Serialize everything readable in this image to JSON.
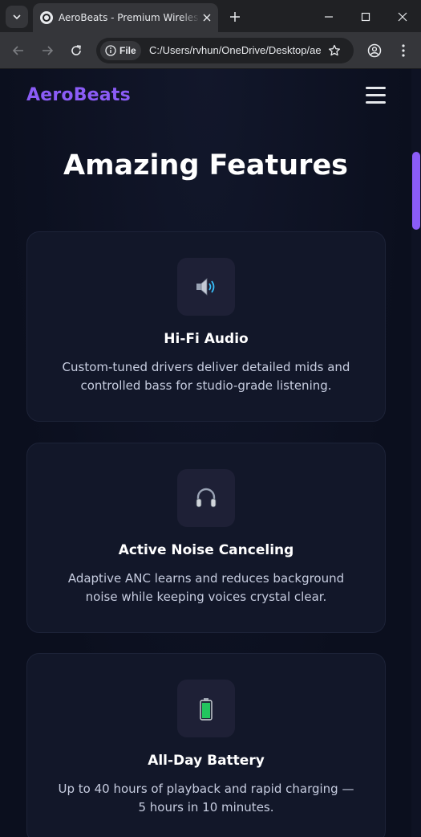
{
  "browser": {
    "tab_title": "AeroBeats - Premium Wireless Headphones",
    "address_chip": "File",
    "url": "C:/Users/rvhun/OneDrive/Desktop/aerobeats/index.html"
  },
  "site": {
    "logo": "AeroBeats",
    "accent_color": "#8b5cf6",
    "section_title": "Amazing Features",
    "features": [
      {
        "icon": "speaker-icon",
        "title": "Hi-Fi Audio",
        "description": "Custom-tuned drivers deliver detailed mids and controlled bass for studio-grade listening."
      },
      {
        "icon": "headphones-icon",
        "title": "Active Noise Canceling",
        "description": "Adaptive ANC learns and reduces background noise while keeping voices crystal clear."
      },
      {
        "icon": "battery-icon",
        "title": "All-Day Battery",
        "description": "Up to 40 hours of playback and rapid charging — 5 hours in 10 minutes."
      }
    ]
  }
}
